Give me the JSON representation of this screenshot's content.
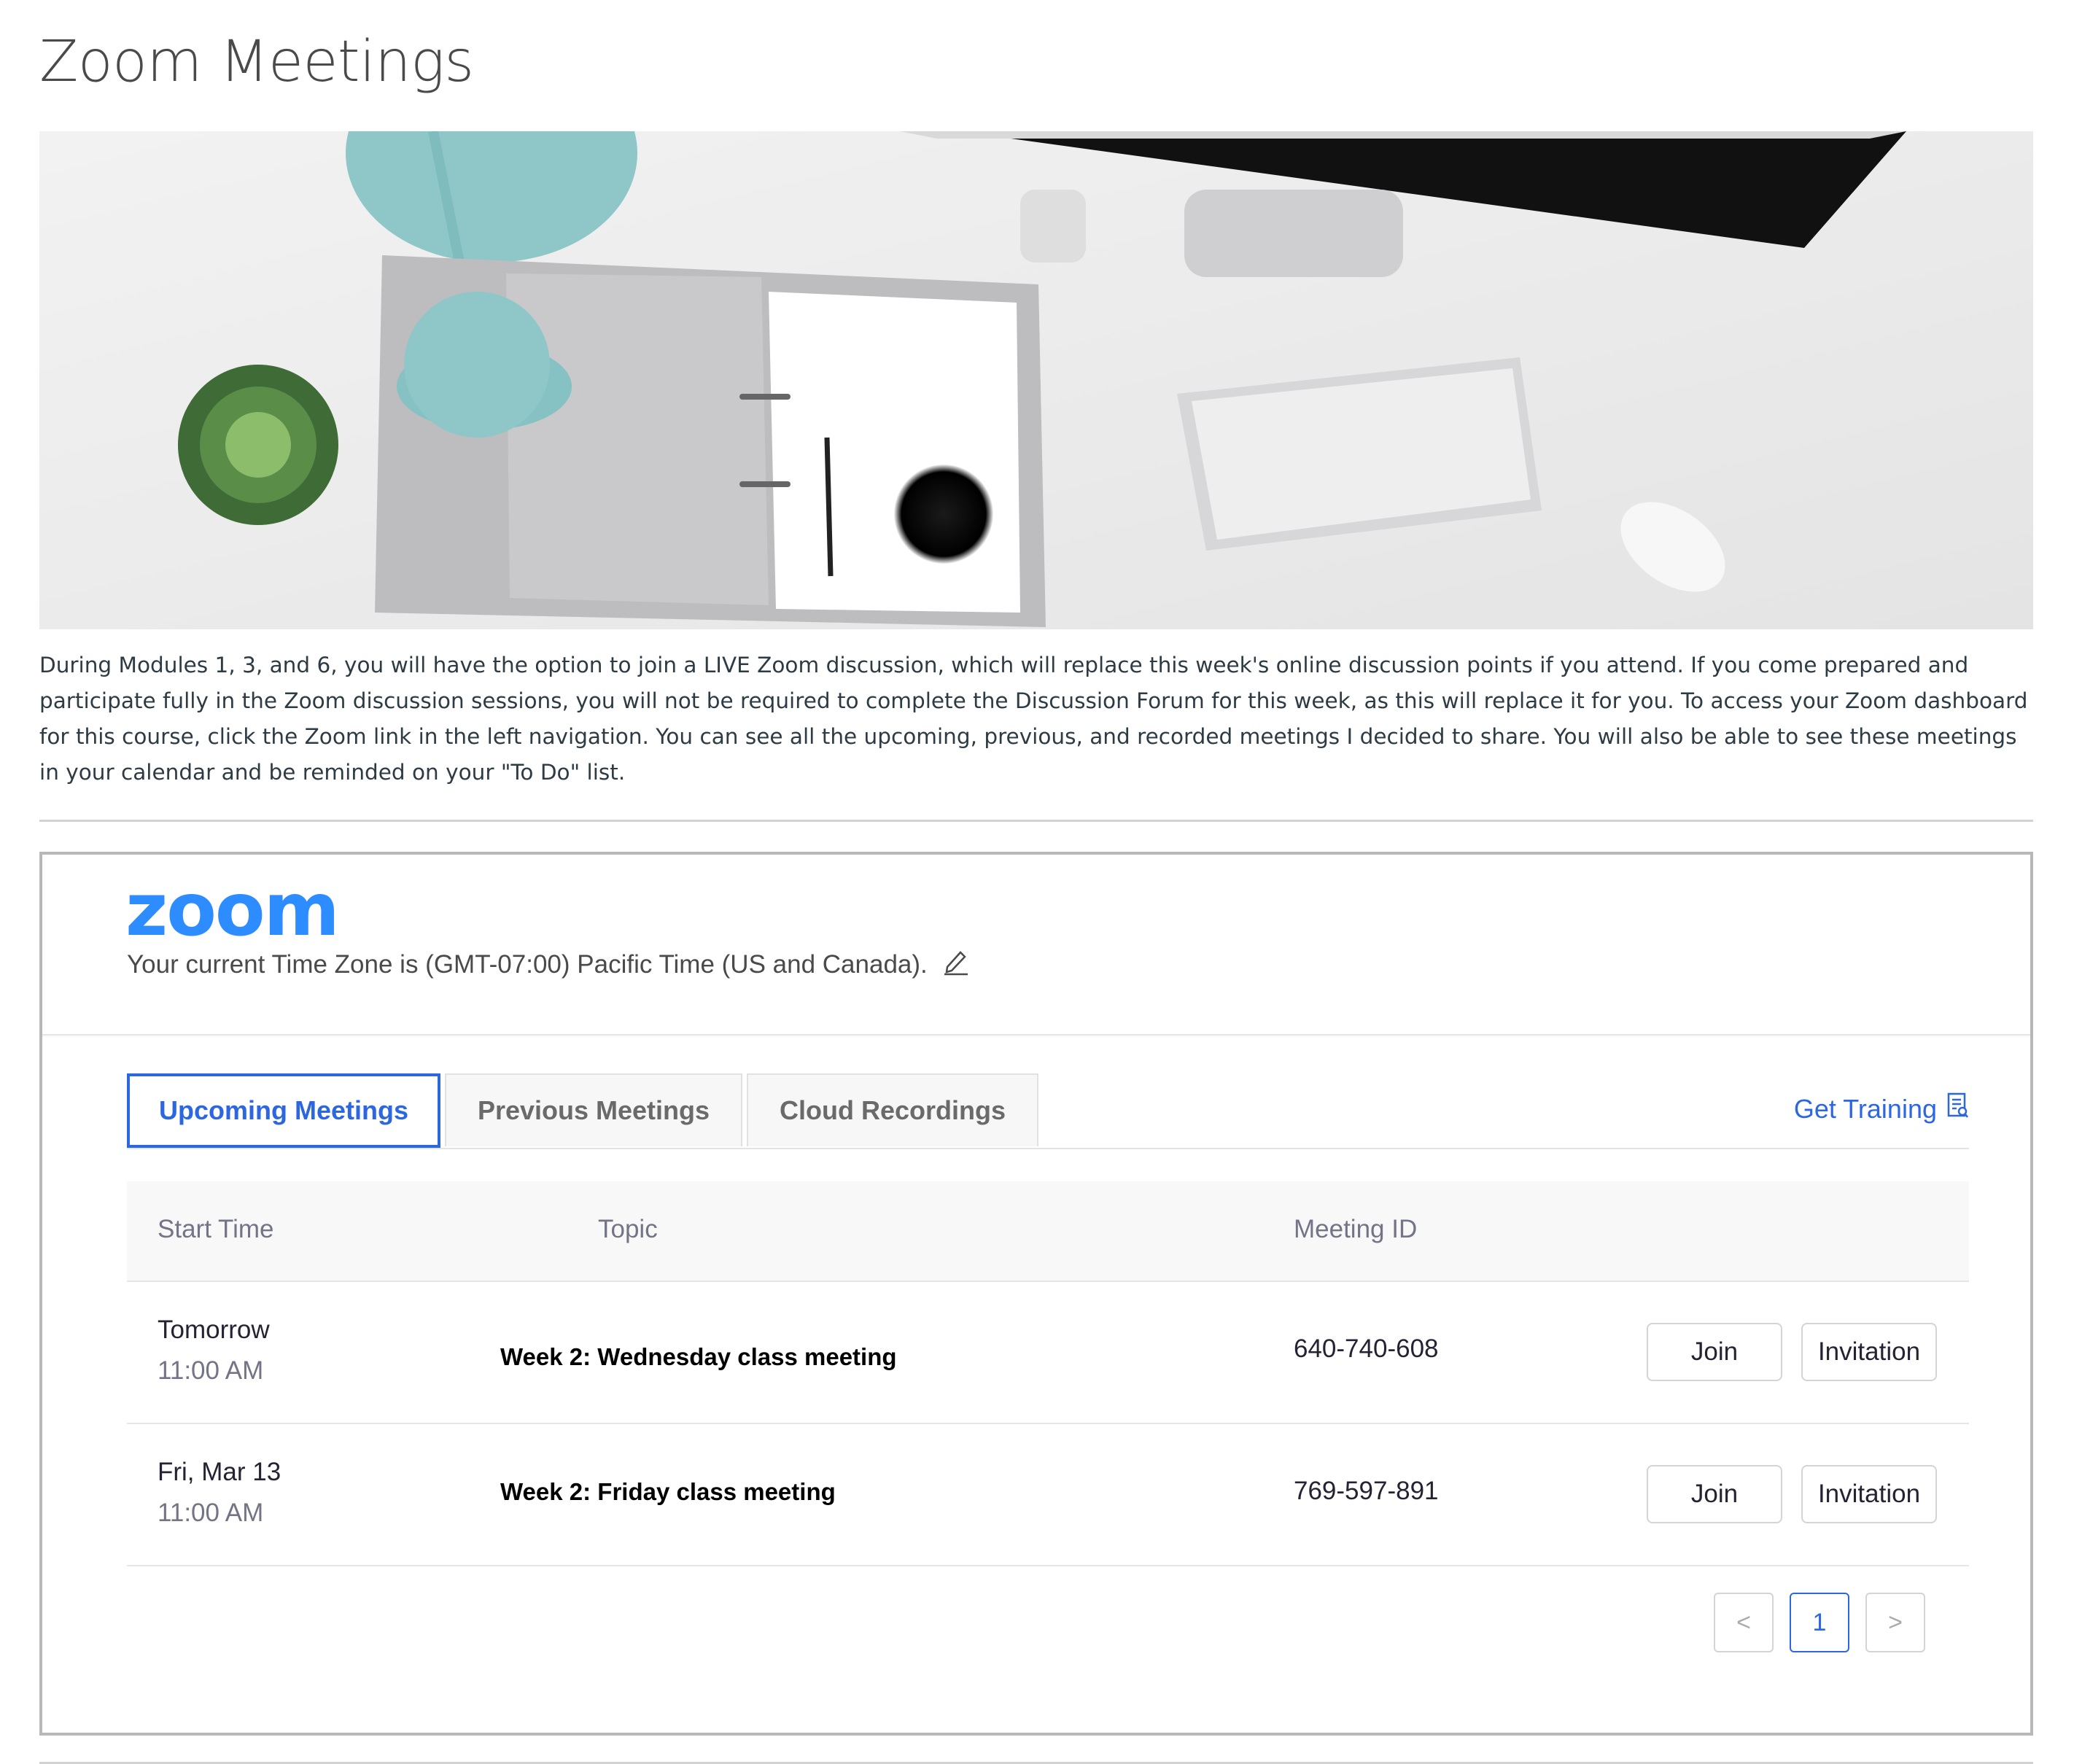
{
  "page": {
    "title": "Zoom Meetings",
    "intro": "During Modules 1, 3, and 6, you will have the option to join a LIVE Zoom discussion, which will replace this week's online discussion points if you attend. If you come prepared and participate fully in the Zoom discussion sessions, you will not be required to complete the Discussion Forum for this week, as this will replace it for you. To access your Zoom dashboard for this course, click the Zoom link in the left navigation. You can see all the upcoming, previous, and recorded meetings I decided to share. You will also be able to see these meetings in your calendar and be reminded on your \"To Do\" list."
  },
  "zoom": {
    "logo": "zoom",
    "timezone_text": "Your current Time Zone is (GMT-07:00) Pacific Time (US and Canada).",
    "edit_icon": "pencil-icon",
    "tabs": [
      {
        "label": "Upcoming Meetings",
        "active": true
      },
      {
        "label": "Previous Meetings",
        "active": false
      },
      {
        "label": "Cloud Recordings",
        "active": false
      }
    ],
    "get_training": "Get Training",
    "training_icon": "document-icon",
    "table": {
      "headers": {
        "start_time": "Start Time",
        "topic": "Topic",
        "meeting_id": "Meeting ID"
      },
      "rows": [
        {
          "day": "Tomorrow",
          "time": "11:00 AM",
          "topic": "Week 2: Wednesday class meeting",
          "meeting_id": "640-740-608",
          "join": "Join",
          "invitation": "Invitation"
        },
        {
          "day": "Fri, Mar 13",
          "time": "11:00 AM",
          "topic": "Week 2: Friday class meeting",
          "meeting_id": "769-597-891",
          "join": "Join",
          "invitation": "Invitation"
        }
      ]
    },
    "pagination": {
      "prev": "<",
      "current": "1",
      "next": ">"
    }
  },
  "colors": {
    "accent": "#2d67e0",
    "zoom_brand": "#2d8cff"
  }
}
